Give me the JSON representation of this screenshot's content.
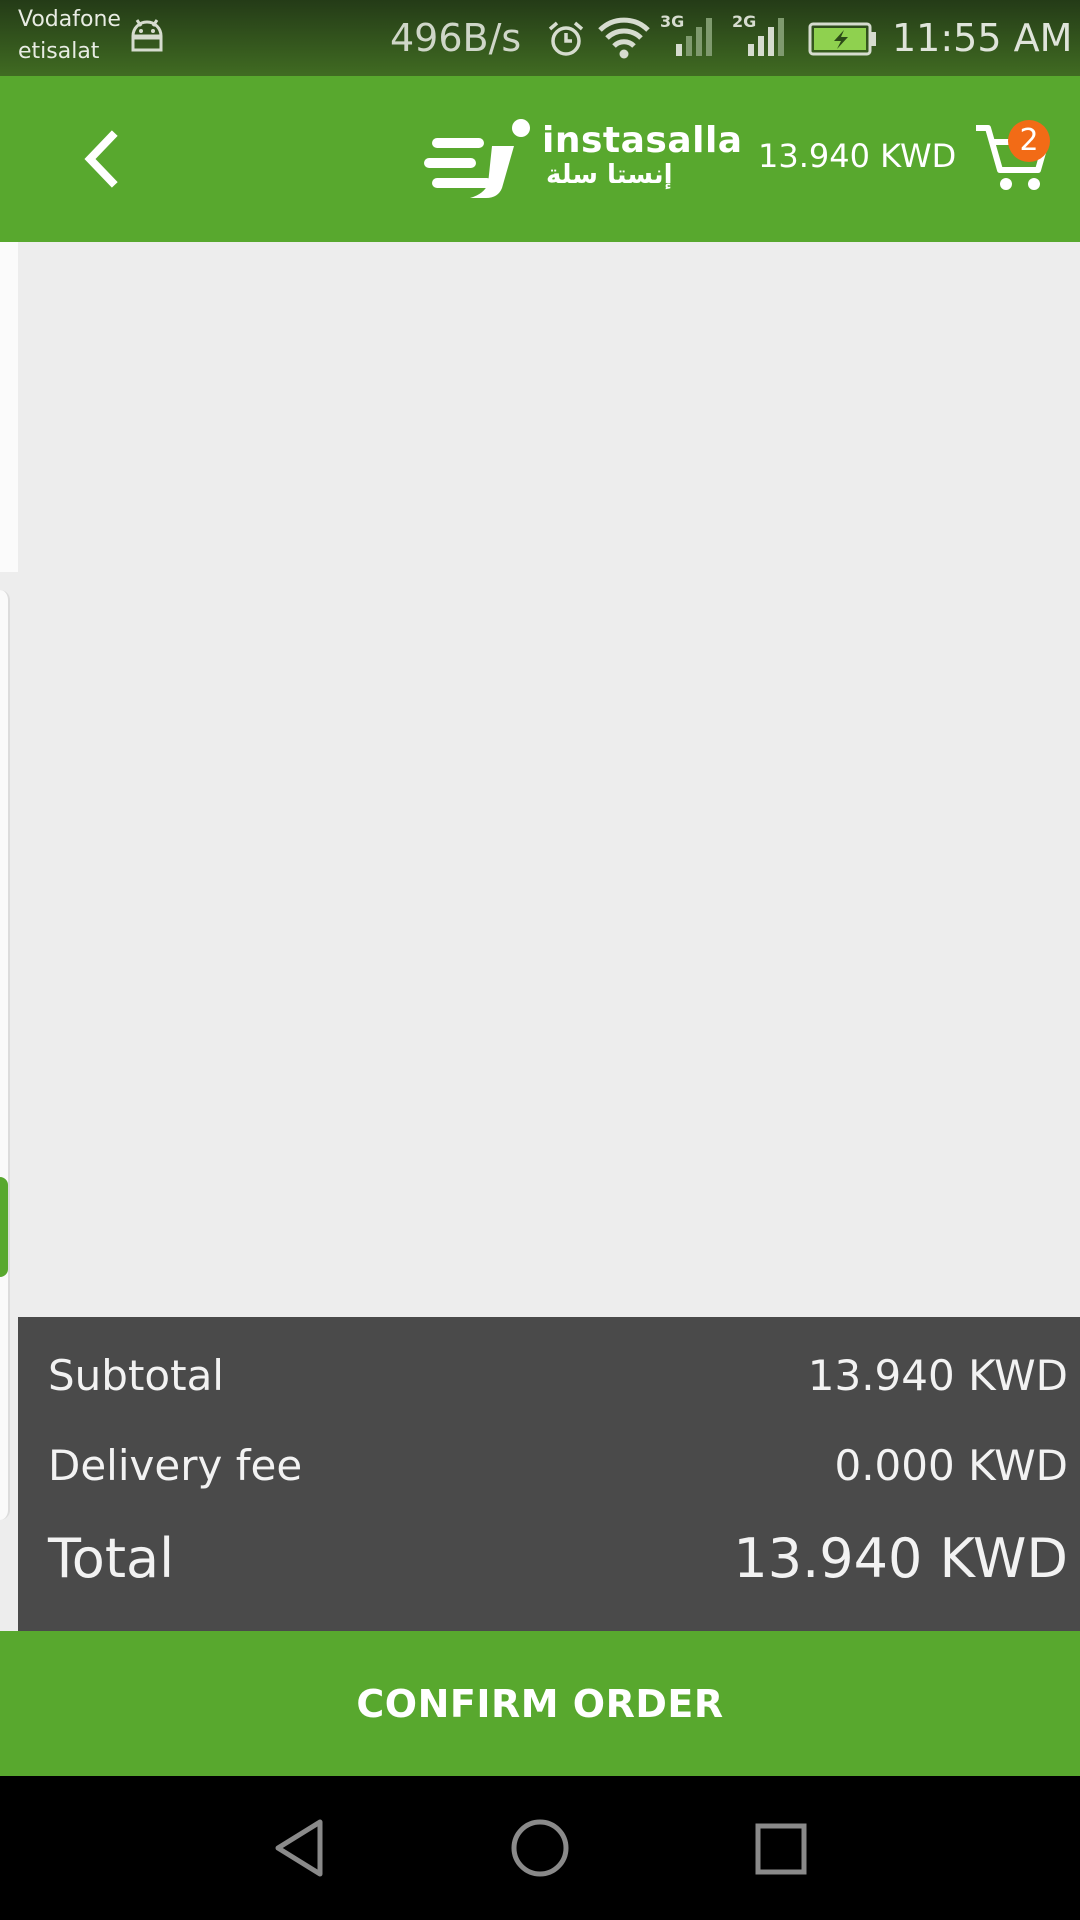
{
  "status_bar": {
    "carrier_1": "Vodafone",
    "carrier_2": "etisalat",
    "net_speed": "496B/s",
    "signal_1_tag": "3G",
    "signal_2_tag": "2G",
    "time": "11:55 AM",
    "icons": [
      "android-icon",
      "alarm-icon",
      "wifi-icon",
      "signal-icon",
      "battery-charging-icon"
    ]
  },
  "app_bar": {
    "logo_en": "instasalla",
    "logo_ar": "إنستا سلة",
    "cart_total": "13.940 KWD",
    "cart_count": "2",
    "colors": {
      "primary": "#58a82e",
      "badge": "#f26b16"
    }
  },
  "summary": {
    "subtotal_label": "Subtotal",
    "subtotal_value": "13.940 KWD",
    "delivery_label": "Delivery fee",
    "delivery_value": "0.000 KWD",
    "total_label": "Total",
    "total_value": "13.940 KWD",
    "colors": {
      "background": "#4a4a4a"
    }
  },
  "confirm_button": {
    "label": "CONFIRM ORDER"
  },
  "nav_bar": {
    "icons": [
      "nav-back-icon",
      "nav-home-icon",
      "nav-recents-icon"
    ]
  }
}
